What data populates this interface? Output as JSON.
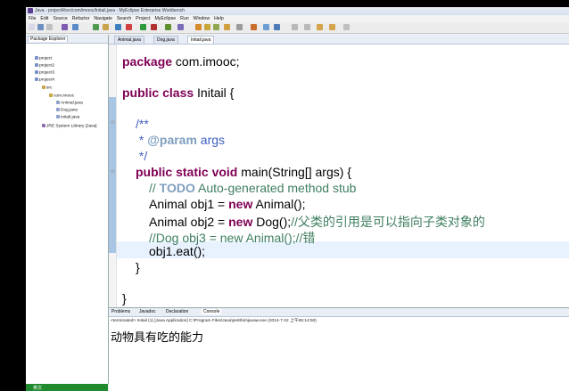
{
  "window": {
    "title": "Java - project4/src/com/imooc/Initail.java - MyEclipse Enterprise Workbench"
  },
  "menu": [
    "File",
    "Edit",
    "Source",
    "Refactor",
    "Navigate",
    "Search",
    "Project",
    "MyEclipse",
    "Run",
    "Window",
    "Help"
  ],
  "package_explorer": {
    "tab_label": "Package Explorer",
    "items": [
      "project",
      "project2",
      "project3",
      "project4",
      "src",
      "com.imooc",
      "Animal.java",
      "Dog.java",
      "Initail.java",
      "JRE System Library [Java]"
    ]
  },
  "editor": {
    "tabs": [
      "Animal.java",
      "Dog.java",
      "Initail.java"
    ],
    "code": {
      "l1_kw": "package",
      "l1_rest": " com.imooc;",
      "l2_kw": "public class",
      "l2_rest": " Initail {",
      "l3": "/**",
      "l4_star": " * ",
      "l4_tag": "@param",
      "l4_rest": " args",
      "l5": " */",
      "l6_kw": "public static void",
      "l6_rest": " main(String[] args) {",
      "l7_pre": "// ",
      "l7_todo": "TODO",
      "l7_rest": " Auto-generated method stub",
      "l8_a": "Animal obj1 = ",
      "l8_kw": "new",
      "l8_b": " Animal();",
      "l9_a": "Animal obj2 = ",
      "l9_kw": "new",
      "l9_b": " Dog();",
      "l9_cm": "//父类的引用是可以指向子类对象的",
      "l10": "//Dog obj3 = new Animal();//错",
      "l11": "obj1.eat();",
      "l12": "}",
      "l13": "}"
    }
  },
  "console": {
    "tabs": [
      "Problems",
      "Javadoc",
      "Declaration",
      "Console"
    ],
    "terminated_line": "<terminated> Initail (1) [Java Application] C:\\Program Files\\Java\\jre6\\bin\\javaw.exe (2014-7-22 上午06:14:50)",
    "output": "动物具有吃的能力"
  },
  "status": {
    "text": "英文"
  }
}
